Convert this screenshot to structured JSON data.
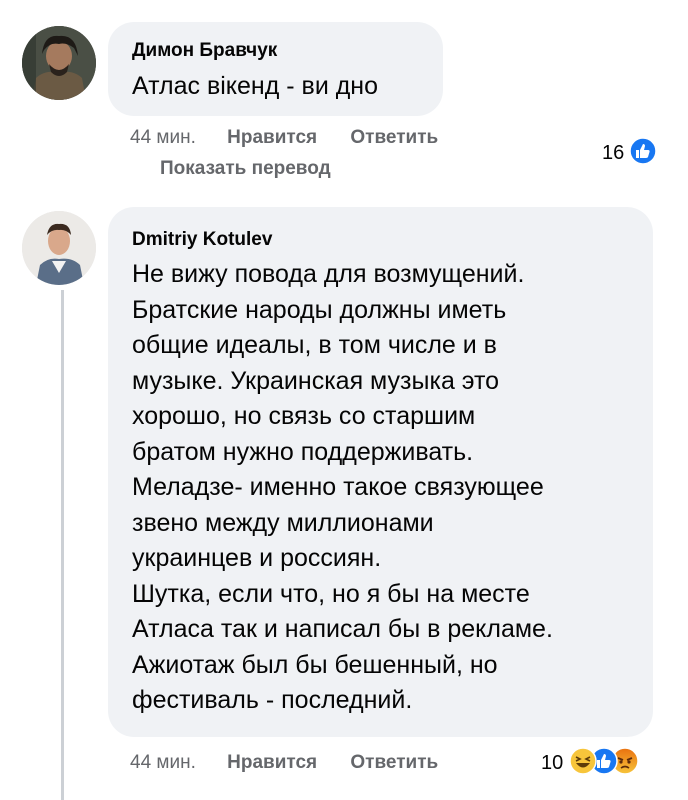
{
  "comments": [
    {
      "author": "Димон Бравчук",
      "text": "Атлас вікенд - ви дно",
      "time": "44 мин.",
      "like_label": "Нравится",
      "reply_label": "Ответить",
      "translate_label": "Показать перевод",
      "reaction_count": "16",
      "reactions": [
        "like-icon"
      ]
    },
    {
      "author": "Dmitriy Kotulev",
      "text_lines": [
        "Не вижу повода для возмущений.",
        "Братские народы должны иметь",
        "общие идеалы, в том числе и в",
        "музыке. Украинская музыка это",
        "хорошо, но связь со старшим",
        "братом нужно поддерживать.",
        "Меладзе- именно такое связующее",
        "звено между миллионами",
        "украинцев и россиян.",
        "Шутка, если что, но я бы на месте",
        "Атласа так и написал бы в рекламе.",
        "Ажиотаж был бы бешенный, но",
        "фестиваль - последний."
      ],
      "time": "44 мин.",
      "like_label": "Нравится",
      "reply_label": "Ответить",
      "reaction_count": "10",
      "reactions": [
        "haha-icon",
        "like-icon",
        "angry-icon"
      ]
    }
  ],
  "colors": {
    "bubble": "#f0f2f5",
    "meta_text": "#65676b",
    "like_blue": "#1877f2",
    "haha_yellow": "#f7c53b",
    "angry_orange": "#e9710f"
  }
}
